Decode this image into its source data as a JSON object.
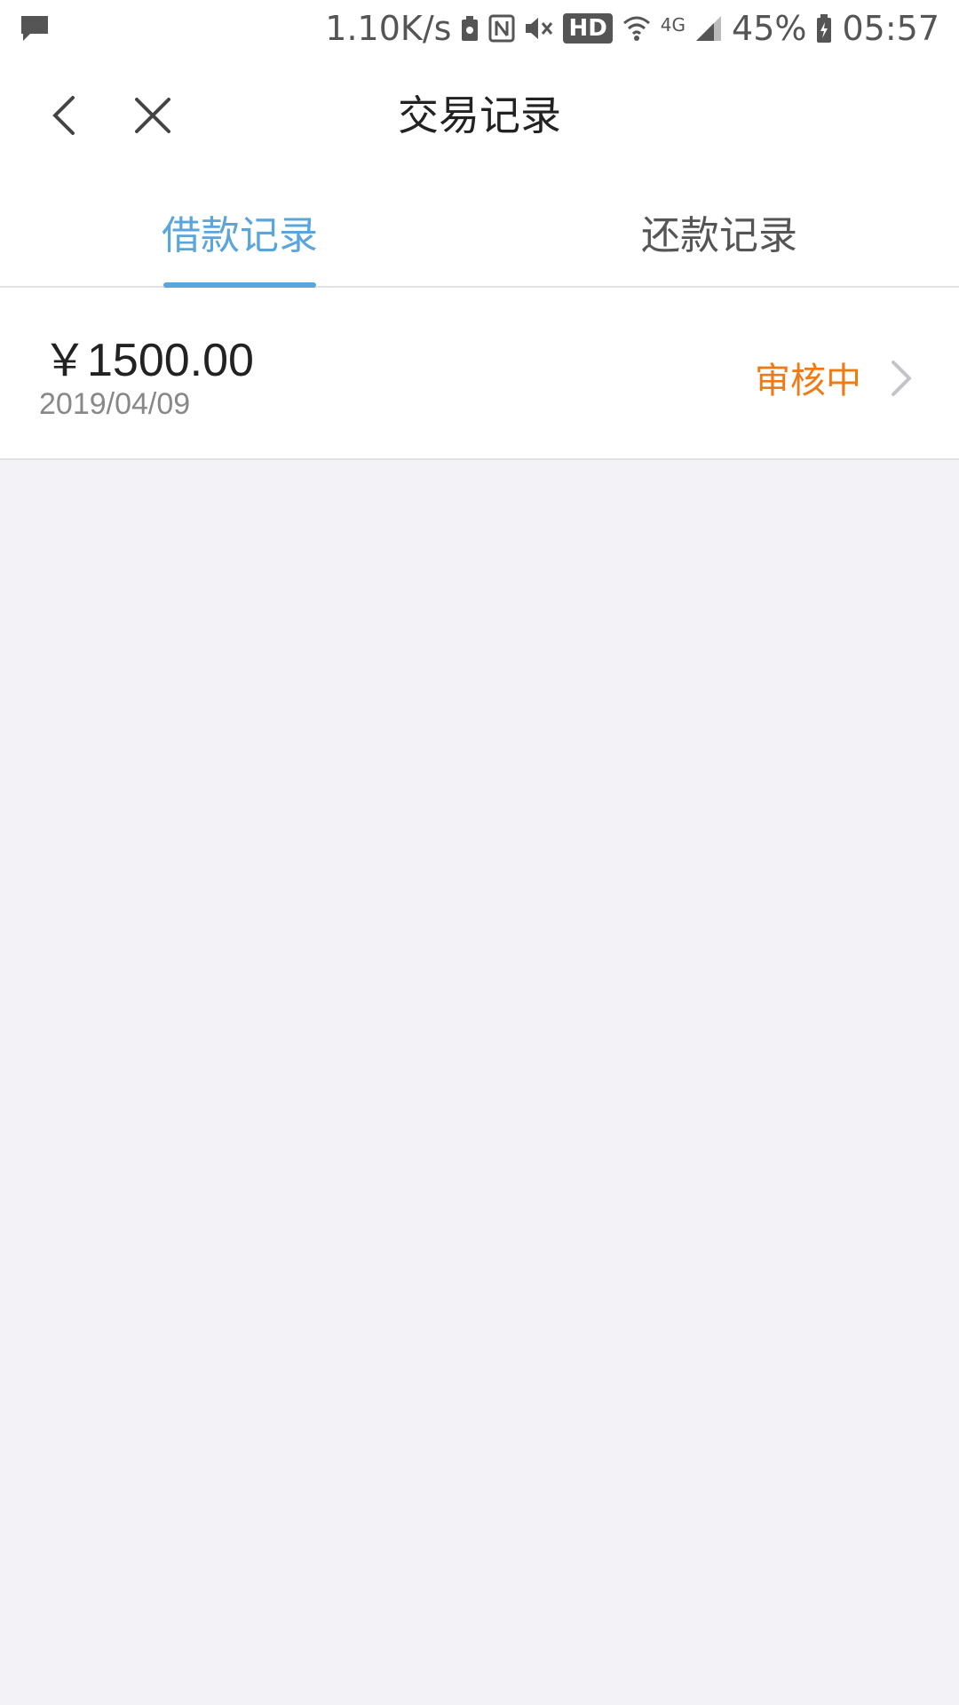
{
  "status_bar": {
    "network_speed": "1.10K/s",
    "hd_label": "HD",
    "network_type": "4G",
    "battery": "45%",
    "time": "05:57",
    "icons": [
      "message-icon",
      "battery-saver-icon",
      "nfc-icon",
      "mute-icon",
      "wifi-icon",
      "signal-icon",
      "battery-icon"
    ]
  },
  "nav": {
    "title": "交易记录",
    "back_icon": "chevron-left-icon",
    "close_icon": "close-icon"
  },
  "tabs": [
    {
      "label": "借款记录",
      "active": true
    },
    {
      "label": "还款记录",
      "active": false
    }
  ],
  "records": [
    {
      "currency": "￥",
      "amount": "1500.00",
      "date": "2019/04/09",
      "status": "审核中"
    }
  ],
  "colors": {
    "accent": "#5aa6dc",
    "status_pending": "#ee7c16",
    "background": "#f2f2f7"
  }
}
